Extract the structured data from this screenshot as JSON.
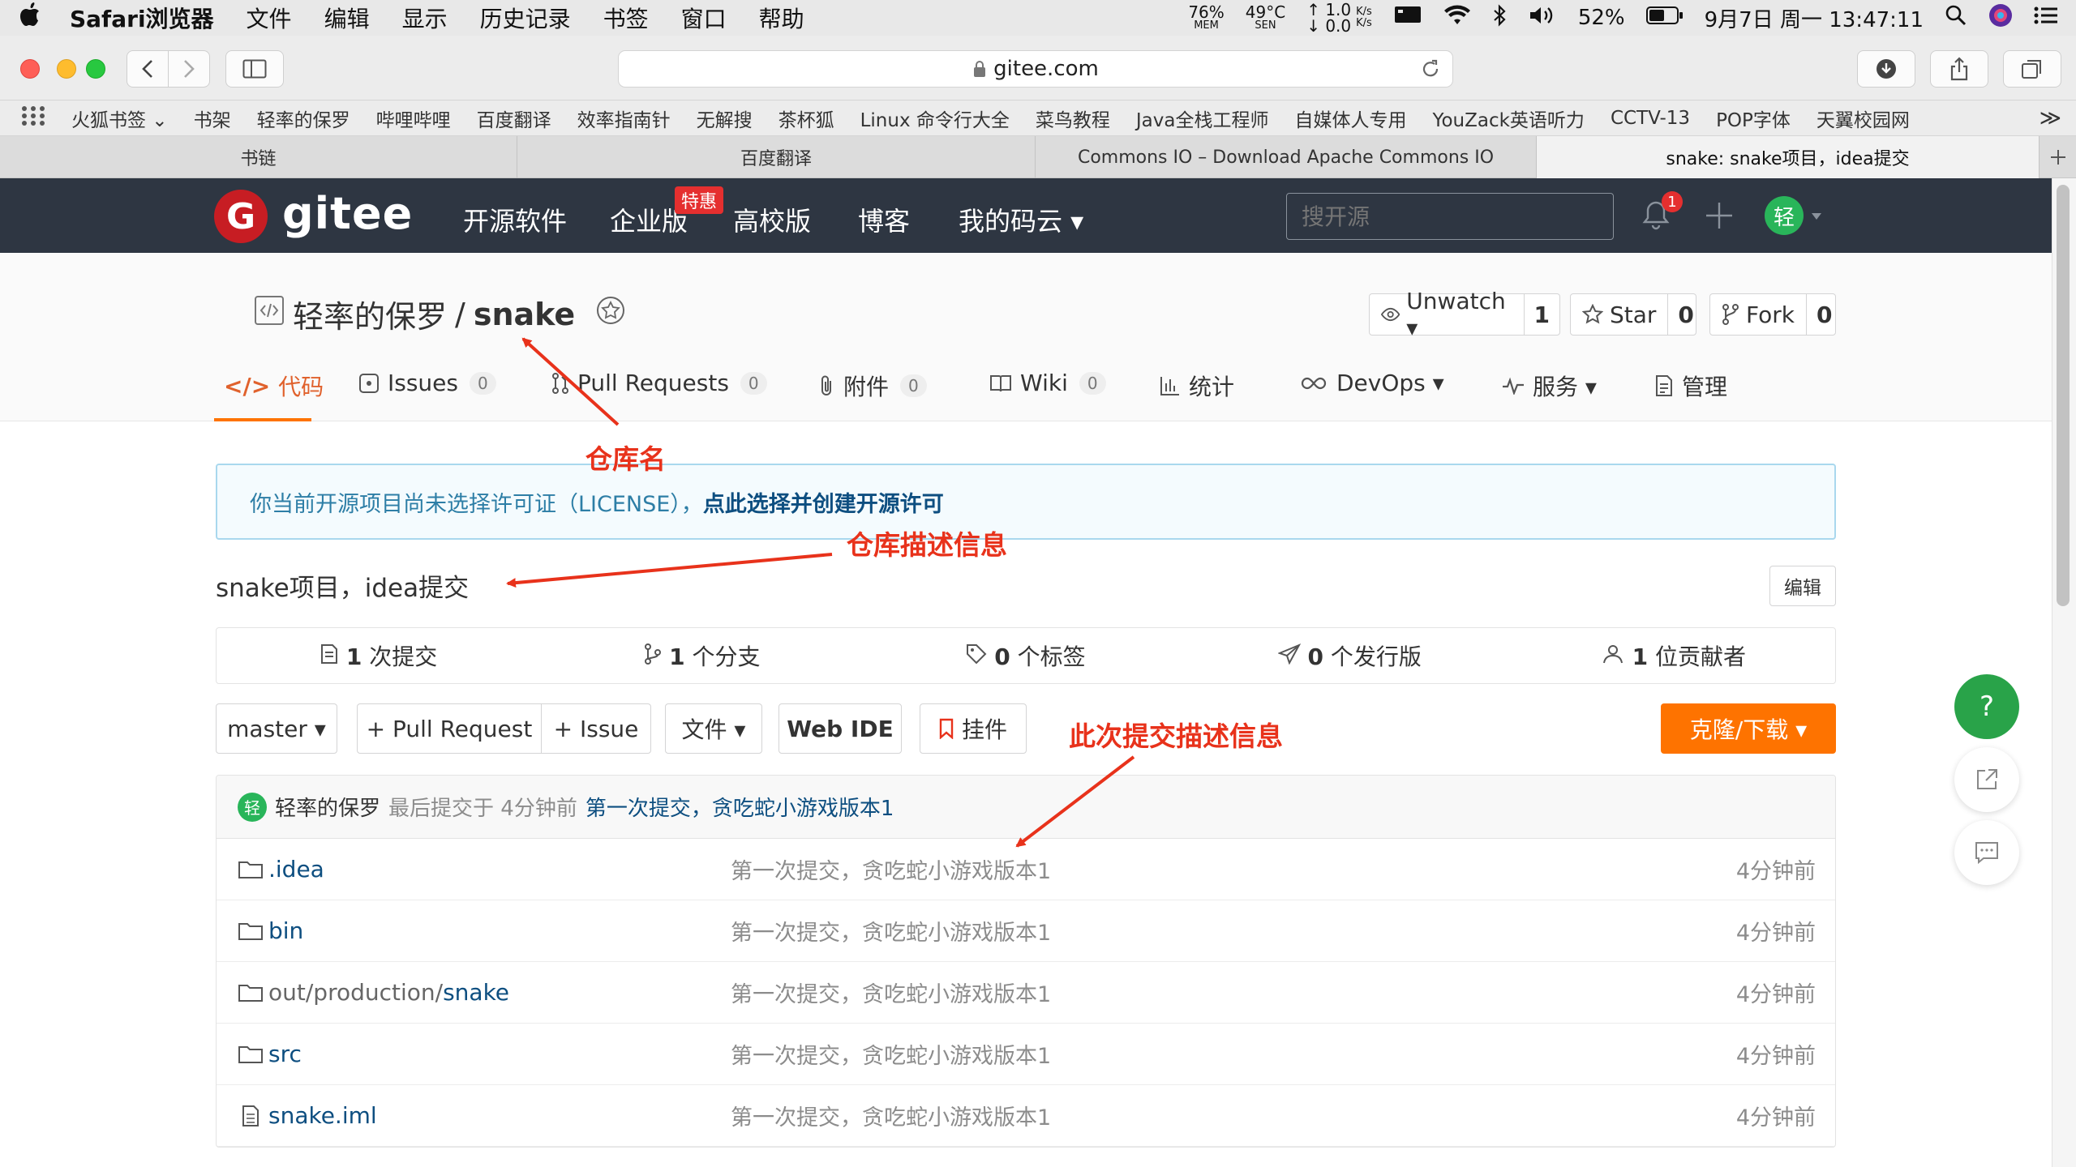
{
  "menubar": {
    "app": "Safari浏览器",
    "items": [
      "文件",
      "编辑",
      "显示",
      "历史记录",
      "书签",
      "窗口",
      "帮助"
    ],
    "mem": "76%",
    "mem_label": "MEM",
    "sen": "49°C",
    "sen_label": "SEN",
    "net_up": "↑ 1.0",
    "net_down": "↓ 0.0",
    "net_unit": "K/s",
    "battery": "52%",
    "datetime": "9月7日 周一  13:47:11"
  },
  "toolbar": {
    "url": "gitee.com"
  },
  "bookmarks": {
    "items": [
      "火狐书签 ⌄",
      "书架",
      "轻率的保罗",
      "哔哩哔哩",
      "百度翻译",
      "效率指南针",
      "无解搜",
      "茶杯狐",
      "Linux 命令行大全",
      "菜鸟教程",
      "Java全栈工程师",
      "自媒体人专用",
      "YouZack英语听力",
      "CCTV-13",
      "POP字体",
      "天翼校园网"
    ],
    "overflow": "≫"
  },
  "tabs": [
    "书链",
    "百度翻译",
    "Commons IO – Download Apache Commons IO",
    "snake: snake项目，idea提交"
  ],
  "gitee": {
    "logo_letter": "G",
    "brand": "gitee",
    "nav": [
      "开源软件",
      "企业版",
      "高校版",
      "博客",
      "我的码云 ▾"
    ],
    "promo_badge": "特惠",
    "search_placeholder": "搜开源",
    "notif_count": "1",
    "user_avatar": "轻"
  },
  "repo": {
    "owner": "轻率的保罗",
    "separator": " / ",
    "name": "snake",
    "unwatch_label": "Unwatch ▾",
    "unwatch_count": "1",
    "star_label": "Star",
    "star_count": "0",
    "fork_label": "Fork",
    "fork_count": "0",
    "tabs": [
      {
        "label": "代码",
        "count": null
      },
      {
        "label": "Issues",
        "count": "0"
      },
      {
        "label": "Pull Requests",
        "count": "0"
      },
      {
        "label": "附件",
        "count": "0"
      },
      {
        "label": "Wiki",
        "count": "0"
      },
      {
        "label": "统计",
        "count": null
      },
      {
        "label": "DevOps ▾",
        "count": null
      },
      {
        "label": "服务 ▾",
        "count": null
      },
      {
        "label": "管理",
        "count": null
      }
    ],
    "license_notice": "你当前开源项目尚未选择许可证（LICENSE），",
    "license_link": "点此选择并创建开源许可",
    "description": "snake项目，idea提交",
    "edit_label": "编辑",
    "stats": [
      {
        "num": "1",
        "label": " 次提交"
      },
      {
        "num": "1",
        "label": " 个分支"
      },
      {
        "num": "0",
        "label": " 个标签"
      },
      {
        "num": "0",
        "label": " 个发行版"
      },
      {
        "num": "1",
        "label": " 位贡献者"
      }
    ],
    "branch": "master ▾",
    "pr_btn": "+ Pull Request",
    "issue_btn": "+ Issue",
    "file_btn": "文件 ▾",
    "webide_btn": "Web IDE",
    "widget_btn": "挂件",
    "clone_btn": "克隆/下载  ▾",
    "commit": {
      "avatar": "轻",
      "author": "轻率的保罗",
      "time_text": "最后提交于 4分钟前",
      "message": "第一次提交，贪吃蛇小游戏版本1"
    },
    "files": [
      {
        "type": "folder",
        "prefix": "",
        "name": ".idea",
        "msg": "第一次提交，贪吃蛇小游戏版本1",
        "time": "4分钟前"
      },
      {
        "type": "folder",
        "prefix": "",
        "name": "bin",
        "msg": "第一次提交，贪吃蛇小游戏版本1",
        "time": "4分钟前"
      },
      {
        "type": "folder",
        "prefix": "out/production/",
        "name": "snake",
        "msg": "第一次提交，贪吃蛇小游戏版本1",
        "time": "4分钟前"
      },
      {
        "type": "folder",
        "prefix": "",
        "name": "src",
        "msg": "第一次提交，贪吃蛇小游戏版本1",
        "time": "4分钟前"
      },
      {
        "type": "file",
        "prefix": "",
        "name": "snake.iml",
        "msg": "第一次提交，贪吃蛇小游戏版本1",
        "time": "4分钟前"
      }
    ]
  },
  "floating": {
    "help": "?"
  },
  "annotations": {
    "repo_name": "仓库名",
    "repo_desc": "仓库描述信息",
    "commit_desc": "此次提交描述信息"
  },
  "colors": {
    "accent": "#fe7300",
    "header": "#2e3642",
    "link": "#0d4e80",
    "annotation": "#e8321b"
  }
}
